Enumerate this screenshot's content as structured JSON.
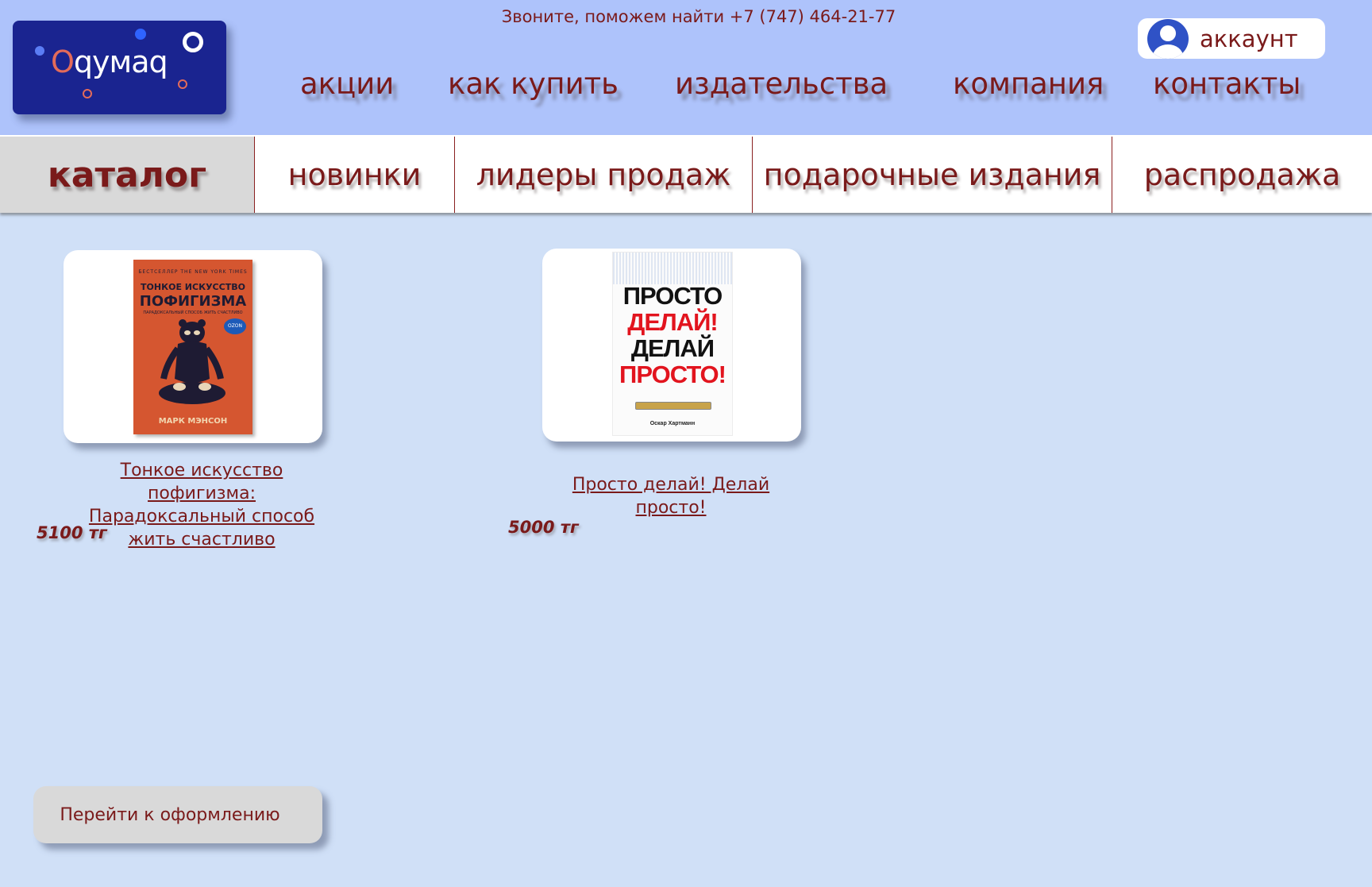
{
  "header": {
    "logo_text_o": "O",
    "logo_text_rest": "qумаq",
    "phone": "Звоните, поможем найти +7 (747) 464-21-77",
    "account_label": "аккаунт",
    "nav": [
      "акции",
      "как купить",
      "издательства",
      "компания",
      "контакты"
    ]
  },
  "categories": [
    "каталог",
    "новинки",
    "лидеры продаж",
    "подарочные издания",
    "распродажа"
  ],
  "products": [
    {
      "title": "Тонкое искусство пофигизма: Парадоксальный способ жить счастливо",
      "price": "5100 тг",
      "cover": {
        "top": "БЕСТСЕЛЛЕР THE NEW YORK TIMES",
        "line1": "ТОНКОЕ ИСКУССТВО",
        "line2": "ПОФИГИЗМА",
        "line3": "ПАРАДОКСАЛЬНЫЙ СПОСОБ ЖИТЬ СЧАСТЛИВО",
        "badge": "OZON",
        "author": "МАРК МЭНСОН"
      }
    },
    {
      "title": "Просто делай! Делай просто!",
      "price": "5000 тг",
      "cover": {
        "line1": "ПРОСТО",
        "line2": "ДЕЛАЙ!",
        "line3": "ДЕЛАЙ",
        "line4": "ПРОСТО!",
        "author": "Оскар Хартманн"
      }
    }
  ],
  "checkout_label": "Перейти к оформлению",
  "colors": {
    "header_bg": "#aec3fb",
    "page_bg": "#d0e0f7",
    "text": "#7a1a1a",
    "logo_bg": "#1a2490"
  }
}
